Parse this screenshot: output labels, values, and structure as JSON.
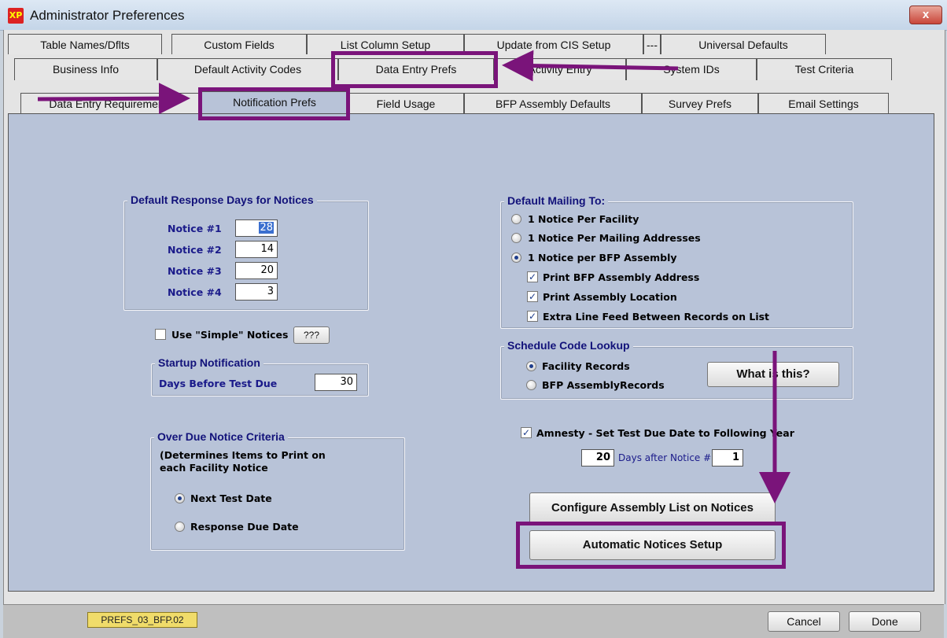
{
  "window": {
    "title": "Administrator Preferences",
    "close_label": "x",
    "icon_text": "XP"
  },
  "tabs_row1": [
    "Table Names/Dflts",
    "Custom Fields",
    "List Column Setup",
    "Update from CIS Setup",
    "---",
    "Universal Defaults"
  ],
  "tabs_row2": [
    "Business Info",
    "Default Activity Codes",
    "Data Entry Prefs",
    "Activity Entry",
    "System IDs",
    "Test Criteria"
  ],
  "tabs_row3": [
    "Data Entry Requirements",
    "Notification Prefs",
    "Field Usage",
    "BFP Assembly Defaults",
    "Survey Prefs",
    "Email Settings"
  ],
  "response_days": {
    "title": "Default Response Days for Notices",
    "notices": [
      {
        "label": "Notice #1",
        "value": "28"
      },
      {
        "label": "Notice #2",
        "value": "14"
      },
      {
        "label": "Notice #3",
        "value": "20"
      },
      {
        "label": "Notice #4",
        "value": "3"
      }
    ]
  },
  "simple_notices": {
    "label": "Use \"Simple\" Notices",
    "help_button": "???",
    "checked": false
  },
  "startup": {
    "title": "Startup Notification",
    "label": "Days Before Test Due",
    "value": "30"
  },
  "overdue": {
    "title": "Over Due Notice Criteria",
    "desc": "(Determines Items to Print on each Facility Notice",
    "option1": "Next Test Date",
    "option2": "Response Due Date",
    "selected": "Next Test Date"
  },
  "mailing": {
    "title": "Default Mailing To:",
    "opt1": "1 Notice Per Facility",
    "opt2": "1 Notice Per Mailing Addresses",
    "opt3": "1 Notice per BFP Assembly",
    "check1": "Print BFP Assembly Address",
    "check2": "Print Assembly Location",
    "check3": "Extra Line Feed Between Records on List"
  },
  "schedule": {
    "title": "Schedule Code Lookup",
    "opt1": "Facility Records",
    "opt2": "BFP AssemblyRecords",
    "what_button": "What is this?"
  },
  "amnesty": {
    "label": "Amnesty - Set Test Due Date to Following Year",
    "days": "20",
    "days_label": "Days after Notice #",
    "notice_no": "1",
    "checked": true
  },
  "buttons": {
    "configure": "Configure Assembly List on Notices",
    "auto": "Automatic Notices Setup",
    "cancel": "Cancel",
    "done": "Done"
  },
  "status_badge": "PREFS_03_BFP.02",
  "colors": {
    "panel": "#b8c3d8",
    "highlight": "#7a147a",
    "group_title": "#12127a"
  }
}
